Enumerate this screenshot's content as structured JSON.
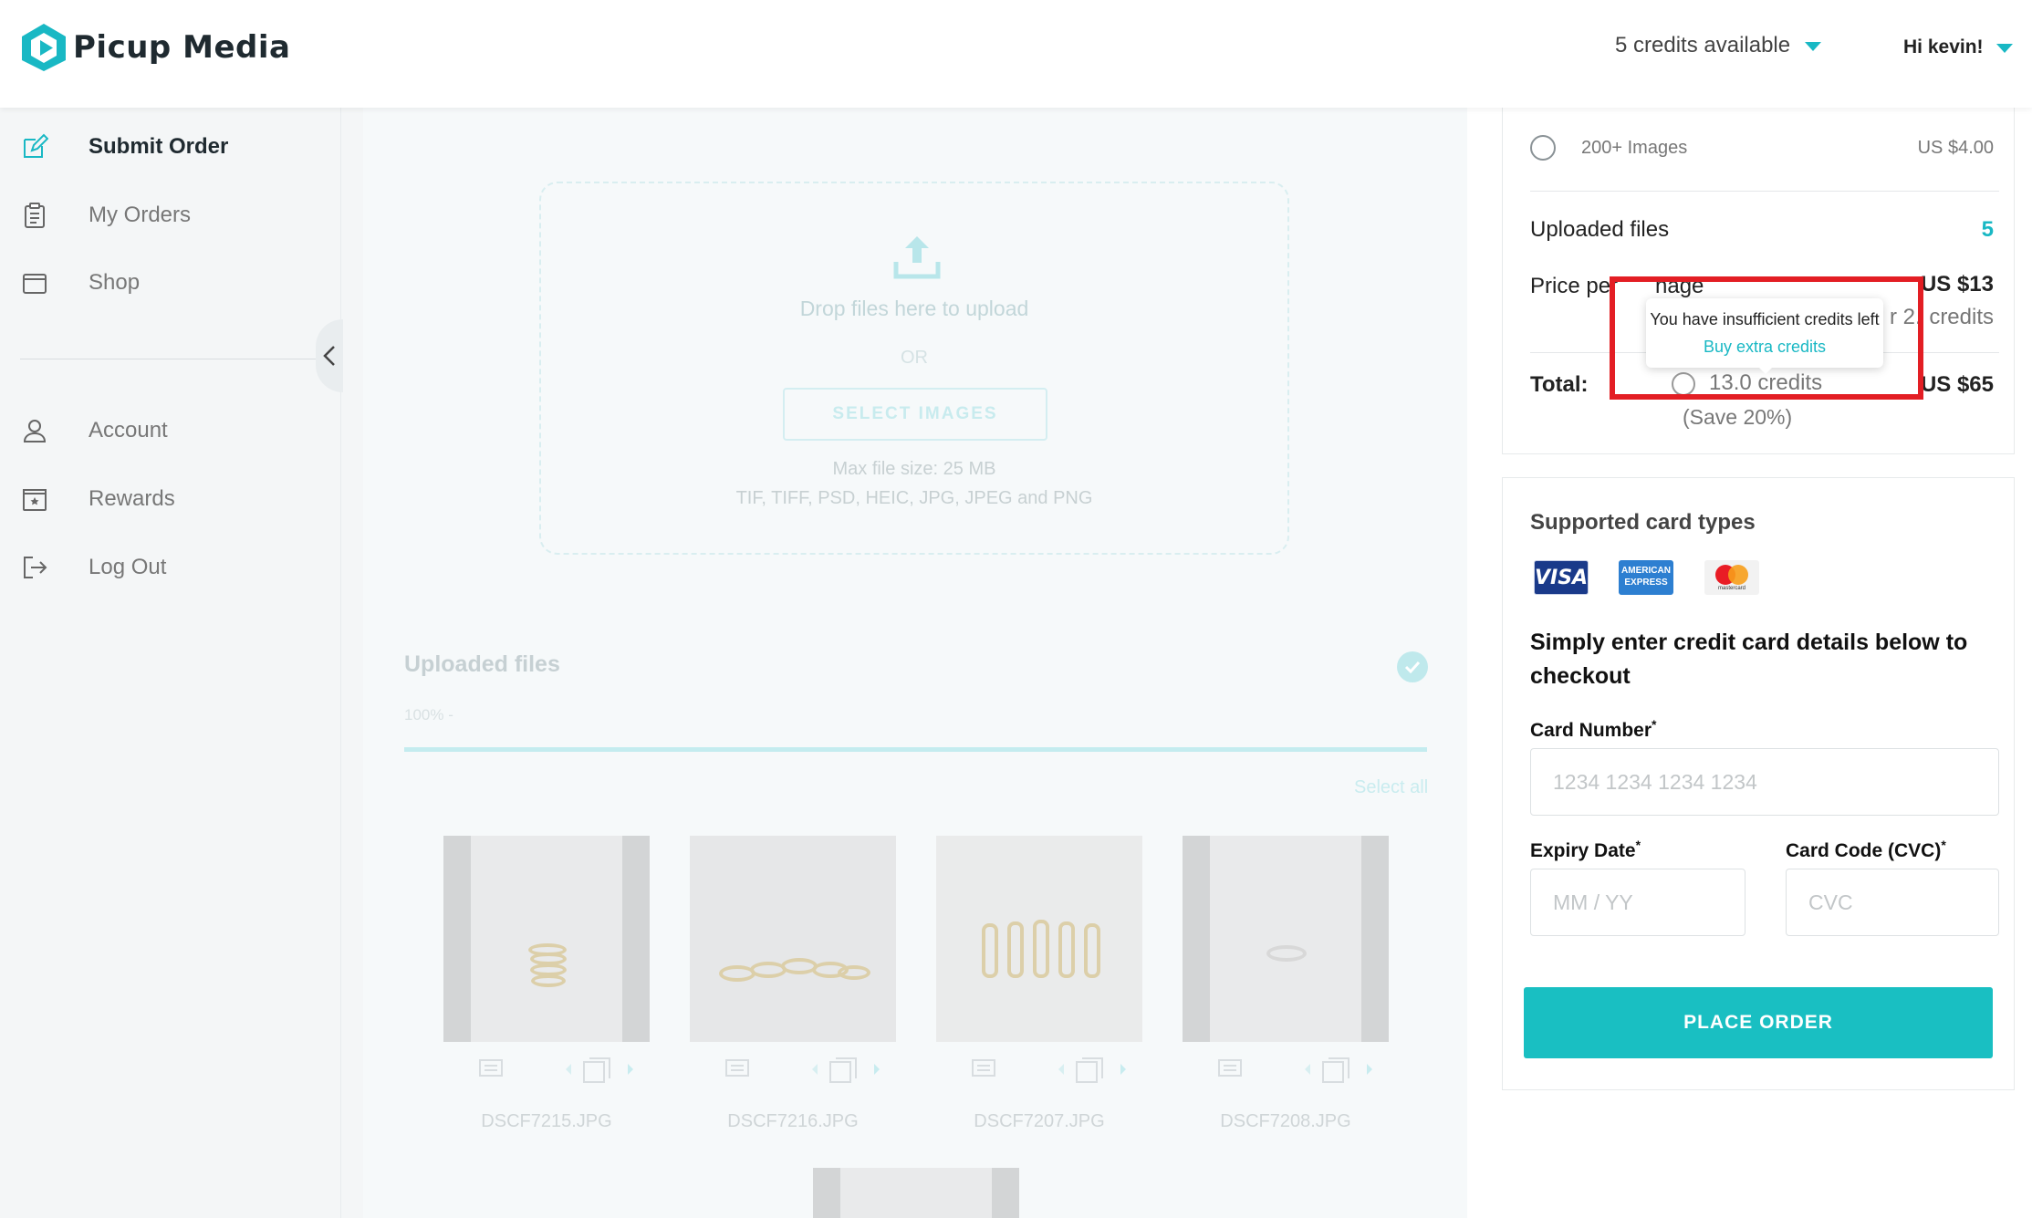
{
  "app": {
    "name": "Picup Media"
  },
  "header": {
    "credits": "5 credits available",
    "greeting": "Hi kevin!"
  },
  "sidebar": {
    "items": [
      {
        "label": "Submit Order"
      },
      {
        "label": "My Orders"
      },
      {
        "label": "Shop"
      },
      {
        "label": "Account"
      },
      {
        "label": "Rewards"
      },
      {
        "label": "Log Out"
      }
    ]
  },
  "upload": {
    "drop_text": "Drop files here to upload",
    "or_text": "OR",
    "select_label": "SELECT IMAGES",
    "max_size": "Max file size: 25 MB",
    "formats": "TIF, TIFF, PSD, HEIC, JPG, JPEG and PNG"
  },
  "uploaded": {
    "title": "Uploaded files",
    "progress_text": "100% -",
    "progress_fraction": 1.0,
    "select_all": "Select all",
    "files": [
      {
        "name": "DSCF7215.JPG"
      },
      {
        "name": "DSCF7216.JPG"
      },
      {
        "name": "DSCF7207.JPG"
      },
      {
        "name": "DSCF7208.JPG"
      }
    ]
  },
  "order": {
    "option_label": "200+ Images",
    "option_price": "US $4.00",
    "uploaded_files_label": "Uploaded files",
    "uploaded_files_count": "5",
    "price_per_label_a": "Price per",
    "price_per_label_b": "nage",
    "price_per_value": "US $13",
    "price_credits_a": "r 2.",
    "price_credits_b": "credits",
    "total_label": "Total:",
    "total_credits": "13.0 credits",
    "total_value": "US $65",
    "save_text": "(Save 20%)"
  },
  "tooltip": {
    "message": "You have insufficient credits left",
    "link": "Buy extra credits"
  },
  "payment": {
    "supported_title": "Supported card types",
    "visa": "VISA",
    "amex_line1": "AMERICAN",
    "amex_line2": "EXPRESS",
    "mastercard": "mastercard",
    "instructions": "Simply enter credit card details below to checkout",
    "card_number_label": "Card Number",
    "card_number_placeholder": "1234 1234 1234 1234",
    "expiry_label": "Expiry Date",
    "expiry_placeholder": "MM / YY",
    "cvc_label": "Card Code (CVC)",
    "cvc_placeholder": "CVC",
    "required_mark": "*",
    "place_order": "PLACE ORDER"
  },
  "colors": {
    "accent": "#19b8c4",
    "highlight": "#e31e24"
  }
}
